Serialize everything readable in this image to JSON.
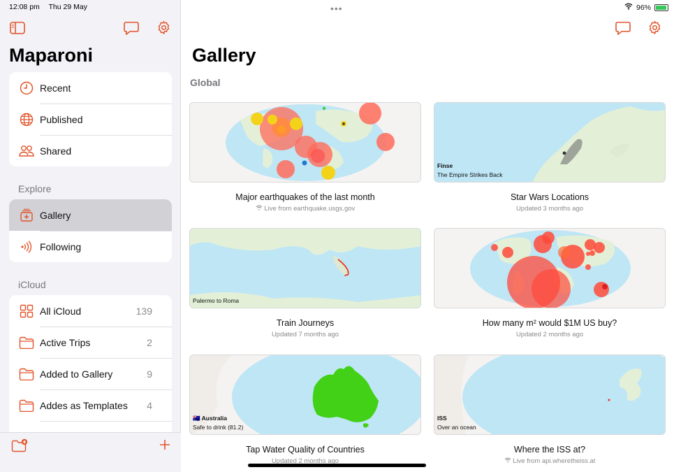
{
  "status": {
    "time": "12:08 pm",
    "date": "Thu 29 May",
    "battery": "96%"
  },
  "sidebar": {
    "title": "Maparoni",
    "library": [
      {
        "label": "Recent",
        "icon": "clock-icon"
      },
      {
        "label": "Published",
        "icon": "globe-icon"
      },
      {
        "label": "Shared",
        "icon": "people-icon"
      }
    ],
    "explore_label": "Explore",
    "explore": [
      {
        "label": "Gallery",
        "icon": "gallery-icon",
        "selected": true
      },
      {
        "label": "Following",
        "icon": "broadcast-icon"
      }
    ],
    "icloud_label": "iCloud",
    "icloud": [
      {
        "label": "All iCloud",
        "count": "139",
        "icon": "grid-icon"
      },
      {
        "label": "Active Trips",
        "count": "2",
        "icon": "folder-icon"
      },
      {
        "label": "Added to Gallery",
        "count": "9",
        "icon": "folder-icon"
      },
      {
        "label": "Addes as Templates",
        "count": "4",
        "icon": "folder-icon"
      }
    ]
  },
  "main": {
    "title": "Gallery",
    "section": "Global",
    "cards": [
      {
        "title": "Major earthquakes of the last month",
        "subtitle": "Live from earthquake.usgs.gov",
        "live": true,
        "caption1": "",
        "caption2": ""
      },
      {
        "title": "Star Wars Locations",
        "subtitle": "Updated 3 months ago",
        "live": false,
        "caption1": "Finse",
        "caption2": "The Empire Strikes Back"
      },
      {
        "title": "Train Journeys",
        "subtitle": "Updated 7 months ago",
        "live": false,
        "caption1": "",
        "caption2": "Palermo to Roma"
      },
      {
        "title": "How many m² would $1M US buy?",
        "subtitle": "Updated 2 months ago",
        "live": false,
        "caption1": "",
        "caption2": ""
      },
      {
        "title": "Tap Water Quality of Countries",
        "subtitle": "Updated 2 months ago",
        "live": false,
        "caption1": "🇦🇺 Australia",
        "caption2": "Safe to drink (81.2)"
      },
      {
        "title": "Where the ISS at?",
        "subtitle": "Live from api.wheretheiss.at",
        "live": true,
        "caption1": "ISS",
        "caption2": "Over an ocean"
      }
    ]
  },
  "colors": {
    "accent": "#e2542a",
    "ocean": "#bfe6f5",
    "land": "#e3f0d7"
  }
}
